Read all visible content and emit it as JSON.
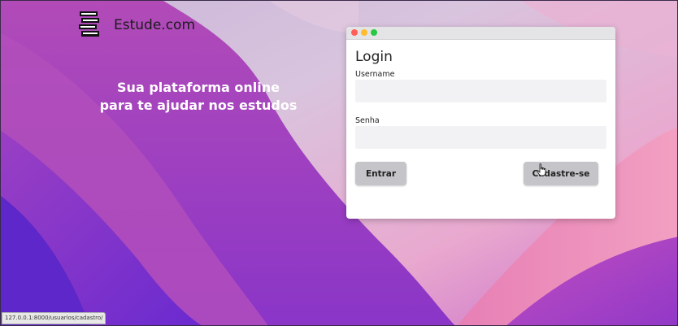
{
  "brand": {
    "site_name": "Estude.com",
    "logo_icon": "books-stack-icon"
  },
  "hero": {
    "tagline_line1": "Sua plataforma online",
    "tagline_line2": "para te ajudar nos estudos"
  },
  "login_card": {
    "title": "Login",
    "window_controls": [
      "close",
      "minimize",
      "maximize"
    ],
    "username_label": "Username",
    "username_value": "",
    "password_label": "Senha",
    "password_value": "",
    "login_button": "Entrar",
    "signup_button": "Cadastre-se"
  },
  "status_bar": {
    "url": "127.0.0.1:8000/usuarios/cadastro/"
  },
  "colors": {
    "background_purple": "#8a3fc4",
    "background_pink": "#e879b8",
    "button_gray": "#c4c4c9",
    "input_gray": "#f2f2f4"
  }
}
